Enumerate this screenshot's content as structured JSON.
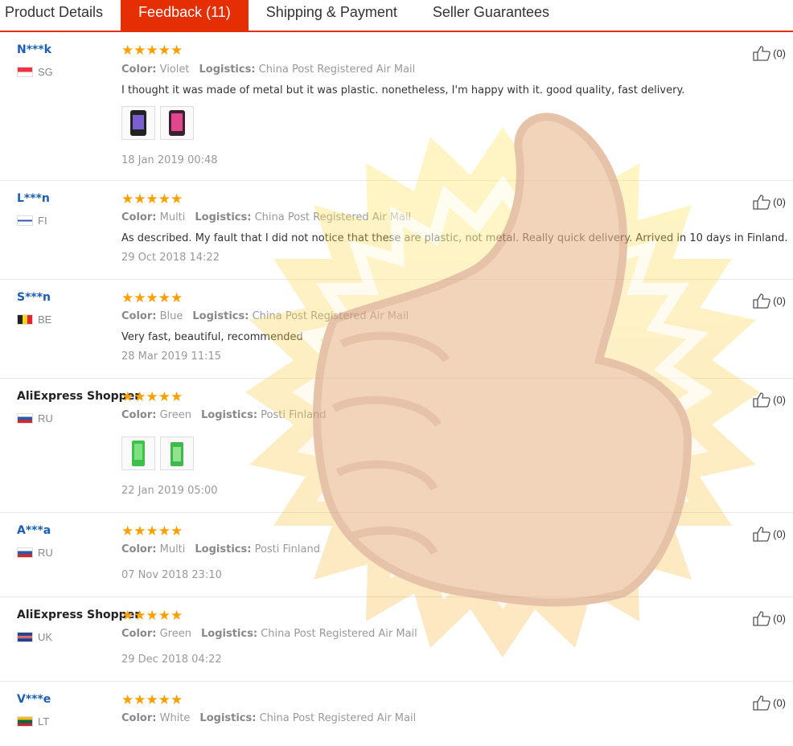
{
  "tabs": [
    {
      "label": "Product Details"
    },
    {
      "label": "Feedback (11)"
    },
    {
      "label": "Shipping & Payment"
    },
    {
      "label": "Seller Guarantees"
    }
  ],
  "labels": {
    "color": "Color:",
    "logistics": "Logistics:"
  },
  "stars": "★★★★★",
  "reviews": [
    {
      "user": "N***k",
      "country": "SG",
      "color": "Violet",
      "logistics": "China Post Registered Air Mail",
      "text": "I thought it was made of metal but it was plastic. nonetheless, I'm happy with it. good quality, fast delivery.",
      "date": "18 Jan 2019 00:48",
      "likes": "(0)",
      "photos": 2
    },
    {
      "user": "L***n",
      "country": "FI",
      "color": "Multi",
      "logistics": "China Post Registered Air Mail",
      "text": "As described. My fault that I did not notice that these are plastic, not metal. Really quick delivery. Arrived in 10 days in Finland.",
      "date": "29 Oct 2018 14:22",
      "likes": "(0)",
      "photos": 0
    },
    {
      "user": "S***n",
      "country": "BE",
      "color": "Blue",
      "logistics": "China Post Registered Air Mail",
      "text": "Very fast, beautiful, recommended",
      "date": "28 Mar 2019 11:15",
      "likes": "(0)",
      "photos": 0
    },
    {
      "user": "AliExpress Shopper",
      "country": "RU",
      "color": "Green",
      "logistics": "Posti Finland",
      "text": "",
      "date": "22 Jan 2019 05:00",
      "likes": "(0)",
      "photos": 2
    },
    {
      "user": "A***a",
      "country": "RU",
      "color": "Multi",
      "logistics": "Posti Finland",
      "text": "",
      "date": "07 Nov 2018 23:10",
      "likes": "(0)",
      "photos": 0
    },
    {
      "user": "AliExpress Shopper",
      "country": "UK",
      "color": "Green",
      "logistics": "China Post Registered Air Mail",
      "text": "",
      "date": "29 Dec 2018 04:22",
      "likes": "(0)",
      "photos": 0
    },
    {
      "user": "V***e",
      "country": "LT",
      "color": "White",
      "logistics": "China Post Registered Air Mail",
      "text": "",
      "date": "",
      "likes": "(0)",
      "photos": 0
    }
  ],
  "colors": {
    "accent": "#e62e04",
    "star": "#ff9f00",
    "user_link": "#1a5fb4"
  }
}
